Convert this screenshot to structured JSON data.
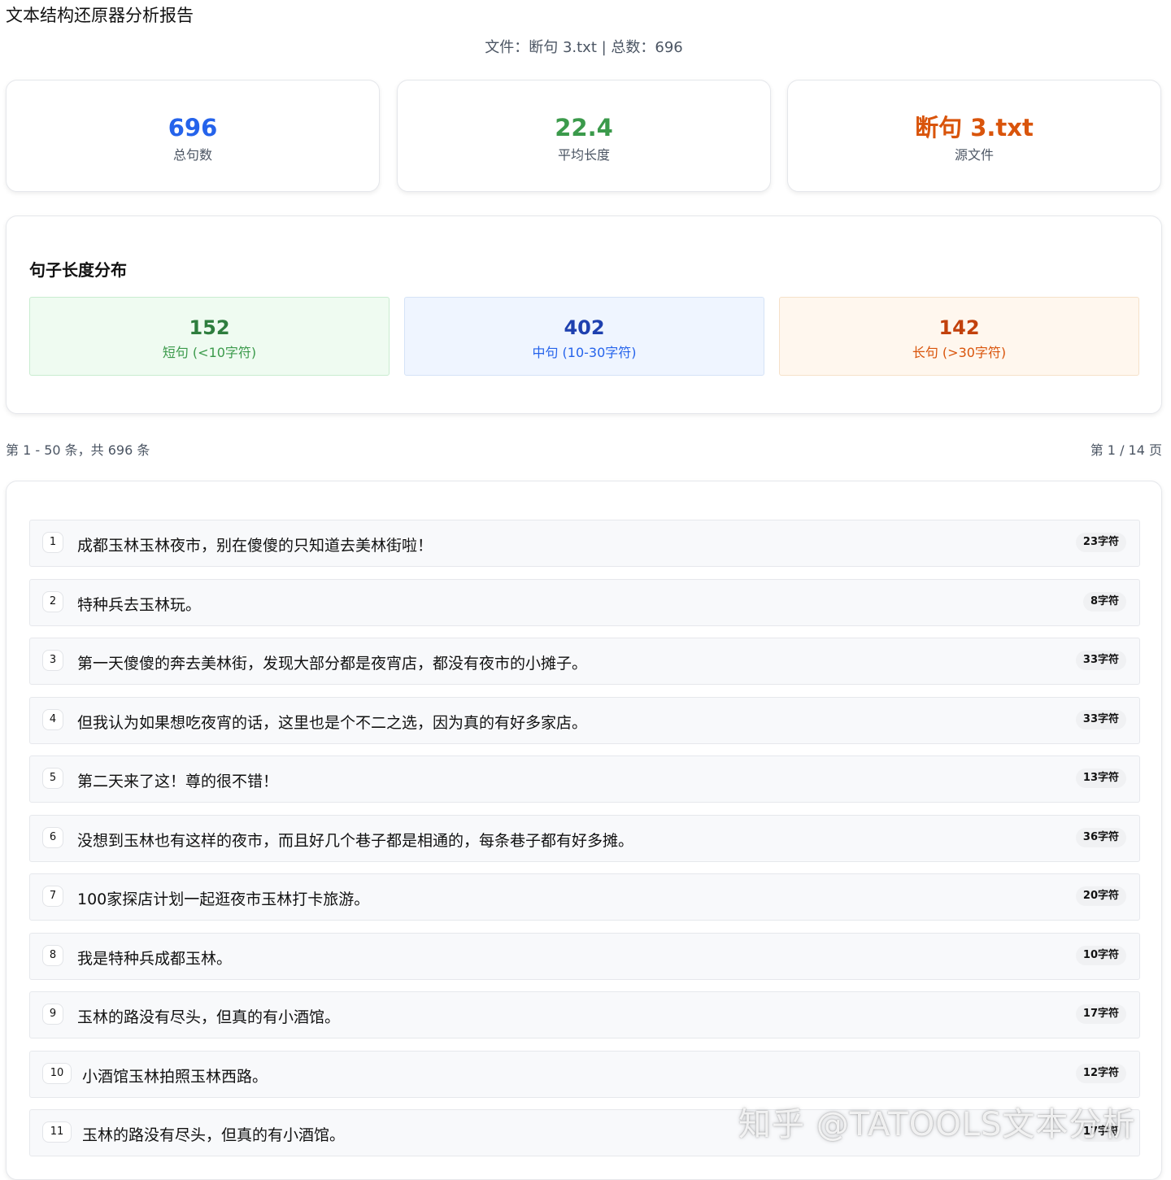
{
  "header": {
    "title": "文本结构还原器分析报告",
    "subtitle": "文件：断句 3.txt | 总数：696"
  },
  "stats": [
    {
      "value": "696",
      "label": "总句数",
      "color": "#2563eb"
    },
    {
      "value": "22.4",
      "label": "平均长度",
      "color": "#3b9a4b"
    },
    {
      "value": "断句 3.txt",
      "label": "源文件",
      "color": "#d9540b"
    }
  ],
  "distribution": {
    "title": "句子长度分布",
    "short": {
      "count": "152",
      "label": "短句 (<10字符)"
    },
    "medium": {
      "count": "402",
      "label": "中句 (10-30字符)"
    },
    "long": {
      "count": "142",
      "label": "长句 (>30字符)"
    }
  },
  "pagination": {
    "range": "第 1 - 50 条，共 696 条",
    "page": "第 1 / 14 页"
  },
  "sentences": [
    {
      "num": "1",
      "text": "成都玉林玉林夜市，别在傻傻的只知道去美林街啦！",
      "length": "23字符"
    },
    {
      "num": "2",
      "text": "特种兵去玉林玩。",
      "length": "8字符"
    },
    {
      "num": "3",
      "text": "第一天傻傻的奔去美林街，发现大部分都是夜宵店，都没有夜市的小摊子。",
      "length": "33字符"
    },
    {
      "num": "4",
      "text": "但我认为如果想吃夜宵的话，这里也是个不二之选，因为真的有好多家店。",
      "length": "33字符"
    },
    {
      "num": "5",
      "text": "第二天来了这！尊的很不错！",
      "length": "13字符"
    },
    {
      "num": "6",
      "text": "没想到玉林也有这样的夜市，而且好几个巷子都是相通的，每条巷子都有好多摊。",
      "length": "36字符"
    },
    {
      "num": "7",
      "text": "100家探店计划一起逛夜市玉林打卡旅游。",
      "length": "20字符"
    },
    {
      "num": "8",
      "text": "我是特种兵成都玉林。",
      "length": "10字符"
    },
    {
      "num": "9",
      "text": "玉林的路没有尽头，但真的有小酒馆。",
      "length": "17字符"
    },
    {
      "num": "10",
      "text": "小酒馆玉林拍照玉林西路。",
      "length": "12字符"
    },
    {
      "num": "11",
      "text": "玉林的路没有尽头，但真的有小酒馆。",
      "length": "17字符"
    }
  ],
  "watermark": "知乎 @TATOOLS文本分析"
}
